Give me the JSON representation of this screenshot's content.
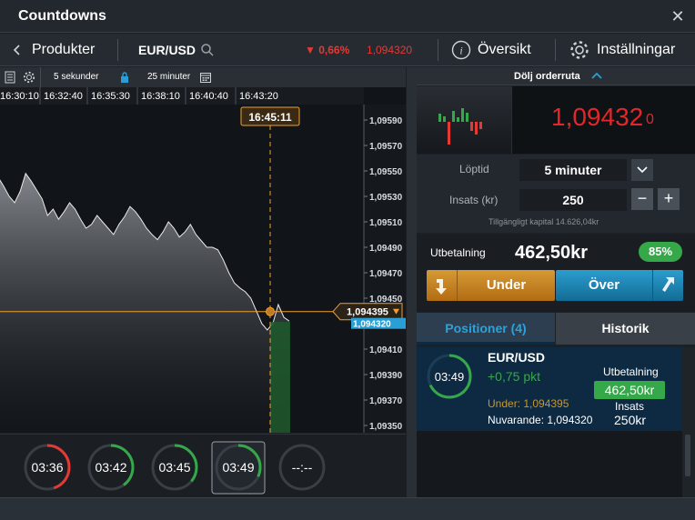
{
  "window": {
    "title": "Countdowns",
    "close": "✕"
  },
  "nav": {
    "back_label": "Produkter",
    "symbol": "EUR/USD",
    "change": "▼ 0,66%",
    "price": "1,094320",
    "overview": "Översikt",
    "settings": "Inställningar",
    "colors": {
      "down": "#e53935",
      "accent": "#f0a030"
    }
  },
  "chart_tools": {
    "interval": "5 sekunder",
    "range": "25 minuter"
  },
  "chart_data": {
    "type": "line",
    "x_ticks": [
      "16:30:10",
      "16:32:40",
      "16:35:30",
      "16:38:10",
      "16:40:40",
      "16:43:20"
    ],
    "y_ticks": [
      "1,09590",
      "1,09570",
      "1,09550",
      "1,09530",
      "1,09510",
      "1,09490",
      "1,09470",
      "1,09450",
      "1,09430",
      "1,09410",
      "1,09390",
      "1,09370",
      "1,09350"
    ],
    "ylim": [
      1.0935,
      1.096
    ],
    "expiry_label": "16:45:11",
    "strike_label": "1,094395",
    "current_label": "1,094320",
    "strike": 1.094395,
    "current": 1.09432,
    "values": [
      1.09545,
      1.09538,
      1.0953,
      1.09525,
      1.09534,
      1.09548,
      1.09542,
      1.09535,
      1.09528,
      1.09515,
      1.0952,
      1.09512,
      1.09518,
      1.09525,
      1.0952,
      1.09512,
      1.09505,
      1.09508,
      1.09515,
      1.0951,
      1.09505,
      1.095,
      1.09508,
      1.09514,
      1.09522,
      1.09518,
      1.09512,
      1.09505,
      1.095,
      1.09496,
      1.09502,
      1.0951,
      1.09505,
      1.09498,
      1.09502,
      1.09508,
      1.095,
      1.09495,
      1.0949,
      1.0949,
      1.09488,
      1.0948,
      1.0947,
      1.09462,
      1.09458,
      1.09455,
      1.0945,
      1.0944,
      1.0943,
      1.09425,
      1.0943,
      1.09445,
      1.09435,
      1.09432
    ]
  },
  "countdowns": [
    "03:36",
    "03:42",
    "03:45",
    "03:49",
    "--:--"
  ],
  "countdown_progress": [
    0.45,
    0.4,
    0.36,
    0.32,
    0
  ],
  "order": {
    "hide_label": "Dölj orderruta",
    "quote_main": "1,09432",
    "quote_small": "0",
    "duration_label": "Löptid",
    "duration_value": "5 minuter",
    "stake_label": "Insats (kr)",
    "stake_value": "250",
    "available": "Tillgängligt kapital 14.626,04kr",
    "payout_label": "Utbetalning",
    "payout_value": "462,50kr",
    "payout_pct": "85%",
    "under_label": "Under",
    "over_label": "Över"
  },
  "tabs": {
    "positions": "Positioner (4)",
    "history": "Historik"
  },
  "position": {
    "timer": "03:49",
    "symbol": "EUR/USD",
    "pips": "+0,75 pkt",
    "payout_label": "Utbetalning",
    "payout_value": "462,50kr",
    "under": "Under: 1,094395",
    "current": "Nuvarande: 1,094320",
    "stake_label": "Insats",
    "stake_value": "250kr"
  }
}
